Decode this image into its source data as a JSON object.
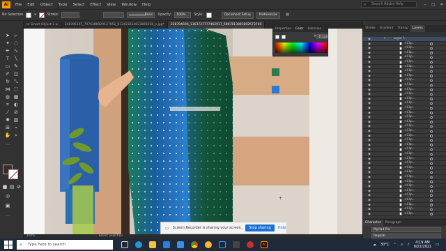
{
  "app": {
    "logo": "Ai"
  },
  "menu": [
    "File",
    "Edit",
    "Object",
    "Type",
    "Select",
    "Effect",
    "View",
    "Window",
    "Help"
  ],
  "search": {
    "placeholder": "Search Adobe Help"
  },
  "control_bar": {
    "selection": "No Selection",
    "stroke_label": "Stroke:",
    "brush": "Basic",
    "opacity_label": "Opacity:",
    "opacity_value": "100%",
    "style_label": "Style:",
    "doc_setup": "Document Setup",
    "preferences": "Preferences"
  },
  "doc_tabs": [
    "to Smart Object-1.ai",
    "24199610T_7976386929127052_6124236346238065S8_n.jpg*",
    "228704596_1163727777462917_5807813893892673705"
  ],
  "color_panel": {
    "tabs": [
      "Properties",
      "Color",
      "Libraries"
    ],
    "hex": "412a24"
  },
  "right_panel": {
    "tabs": [
      "Stroke",
      "Gradient",
      "Transp",
      "Layers"
    ],
    "layer_name": "Layer 1",
    "row_label": "<Clip...",
    "char_tabs": [
      "Character",
      "Paragraph"
    ],
    "font": "Myriad Pro",
    "style": "Regular"
  },
  "status": {
    "zoom": "100%",
    "tool": "Select Selection"
  },
  "notification": {
    "message": "Screen Recorder is sharing your screen.",
    "stop": "Stop sharing",
    "hide": "Hide"
  },
  "taskbar": {
    "search_placeholder": "Type here to search",
    "weather": "30°C",
    "time": "4:19 AM",
    "date": "9/21/2021"
  },
  "colors": {
    "fill": "#412a24",
    "accent": "#1a6fd4"
  }
}
